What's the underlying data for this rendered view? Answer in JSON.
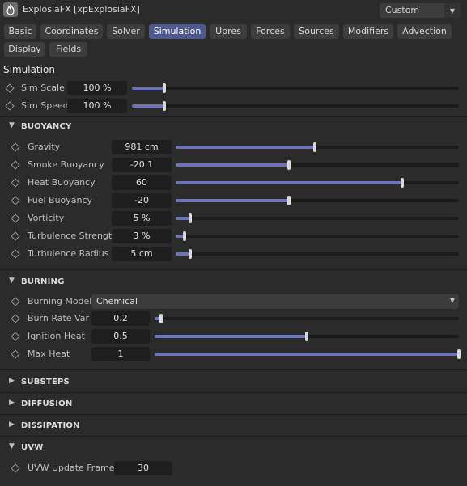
{
  "app": {
    "title": "ExplosiaFX [xpExplosiaFX]",
    "preset": "Custom"
  },
  "tabs": [
    {
      "label": "Basic"
    },
    {
      "label": "Coordinates"
    },
    {
      "label": "Solver"
    },
    {
      "label": "Simulation"
    },
    {
      "label": "Upres"
    },
    {
      "label": "Forces"
    },
    {
      "label": "Sources"
    },
    {
      "label": "Modifiers"
    },
    {
      "label": "Advection"
    },
    {
      "label": "Display"
    },
    {
      "label": "Fields"
    }
  ],
  "active_tab": "Simulation",
  "page_title": "Simulation",
  "top_params": [
    {
      "label": "Sim Scale",
      "value": "100 %",
      "level": 0.1
    },
    {
      "label": "Sim Speed",
      "value": "100 %",
      "level": 0.1
    }
  ],
  "groups": {
    "buoyancy": {
      "title": "BUOYANCY",
      "params": [
        {
          "label": "Gravity",
          "value": "981 cm",
          "level": 0.49
        },
        {
          "label": "Smoke Buoyancy",
          "value": "-20.1",
          "level": 0.4
        },
        {
          "label": "Heat Buoyancy",
          "value": "60",
          "level": 0.8
        },
        {
          "label": "Fuel Buoyancy",
          "value": "-20",
          "level": 0.4
        },
        {
          "label": "Vorticity",
          "value": "5 %",
          "level": 0.05
        },
        {
          "label": "Turbulence Strength",
          "value": "3 %",
          "level": 0.03
        },
        {
          "label": "Turbulence Radius",
          "value": "5 cm",
          "level": 0.05
        }
      ]
    },
    "burning": {
      "title": "BURNING",
      "model_label": "Burning Model",
      "model_value": "Chemical",
      "params": [
        {
          "label": "Burn Rate Var",
          "value": "0.2",
          "level": 0.02
        },
        {
          "label": "Ignition Heat",
          "value": "0.5",
          "level": 0.5
        },
        {
          "label": "Max Heat",
          "value": "1",
          "level": 1.0
        }
      ]
    },
    "substeps": {
      "title": "SUBSTEPS"
    },
    "diffusion": {
      "title": "DIFFUSION"
    },
    "dissipation": {
      "title": "DISSIPATION"
    },
    "uvw": {
      "title": "UVW",
      "params": [
        {
          "label": "UVW Update Frames",
          "value": "30"
        }
      ]
    }
  },
  "icons": {
    "expanded": "chevron-down-icon",
    "collapsed": "chevron-right-icon",
    "keyframe": "diamond-icon"
  },
  "colors": {
    "accent": "#6d74b8",
    "tab_active": "#4e5a8e",
    "background": "#2b2b2b"
  }
}
